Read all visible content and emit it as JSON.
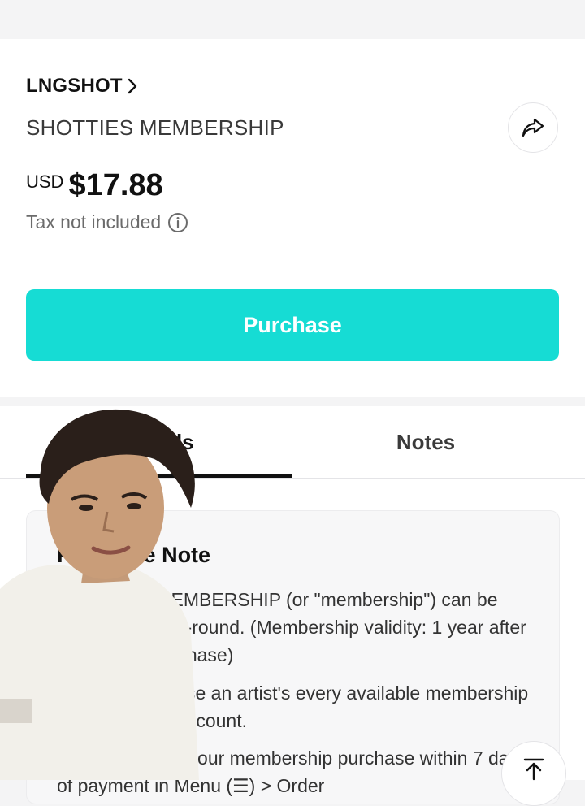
{
  "product": {
    "artist": "LNGSHOT",
    "title": "SHOTTIES MEMBERSHIP",
    "currency": "USD",
    "price": "$17.88",
    "tax_note": "Tax not included"
  },
  "actions": {
    "purchase_label": "Purchase"
  },
  "tabs": [
    {
      "label": "Details",
      "active": true
    },
    {
      "label": "Notes",
      "active": false
    }
  ],
  "notice": {
    "title": "Purchase Note",
    "paragraphs": [
      "SHOTTIES MEMBERSHIP (or \"membership\") can be purchased year-round. (Membership validity: 1 year after the date of purchase)",
      "You can purchase an artist's every available membership using a single account.",
      "You can cancel your membership purchase within 7 days of payment in Menu (☰) > Order"
    ]
  },
  "icons": {
    "share": "share-icon",
    "info": "info-icon",
    "scroll_top": "arrow-up-to-top-icon",
    "chevron": "chevron-right-icon"
  },
  "colors": {
    "accent": "#16dcd4"
  }
}
